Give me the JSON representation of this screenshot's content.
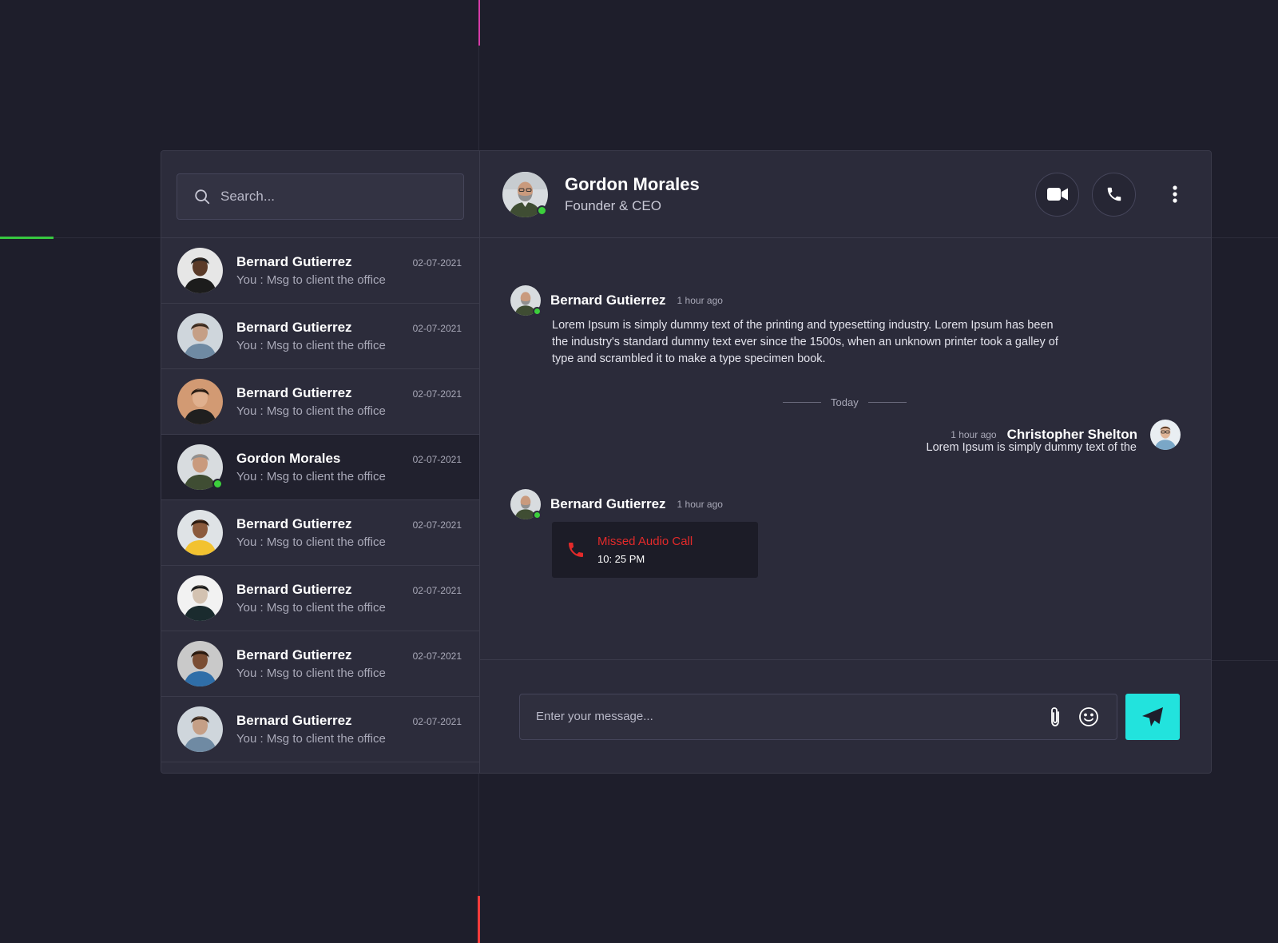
{
  "search": {
    "placeholder": "Search..."
  },
  "contacts": [
    {
      "name": "Bernard Gutierrez",
      "date": "02-07-2021",
      "preview": "You : Msg to client the office",
      "avatar": "man-suit"
    },
    {
      "name": "Bernard Gutierrez",
      "date": "02-07-2021",
      "preview": "You : Msg to client the office",
      "avatar": "man-denim"
    },
    {
      "name": "Bernard Gutierrez",
      "date": "02-07-2021",
      "preview": "You : Msg to client the office",
      "avatar": "man-sunglasses"
    },
    {
      "name": "Gordon Morales",
      "date": "02-07-2021",
      "preview": "You : Msg to client the office",
      "avatar": "man-bald",
      "active": true,
      "online": true
    },
    {
      "name": "Bernard Gutierrez",
      "date": "02-07-2021",
      "preview": "You : Msg to client the office",
      "avatar": "woman-yellow"
    },
    {
      "name": "Bernard Gutierrez",
      "date": "02-07-2021",
      "preview": "You : Msg to client the office",
      "avatar": "person-mug"
    },
    {
      "name": "Bernard Gutierrez",
      "date": "02-07-2021",
      "preview": "You : Msg to client the office",
      "avatar": "woman-curly"
    },
    {
      "name": "Bernard Gutierrez",
      "date": "02-07-2021",
      "preview": "You : Msg to client the office",
      "avatar": "man-denim"
    }
  ],
  "header": {
    "name": "Gordon Morales",
    "role": "Founder & CEO",
    "video_icon": "video-camera-icon",
    "call_icon": "phone-icon",
    "more_icon": "vertical-dots-icon"
  },
  "messages": {
    "first": {
      "sender": "Bernard Gutierrez",
      "time": "1 hour ago",
      "text": "Lorem Ipsum is simply dummy text of the printing and typesetting industry. Lorem Ipsum has been the industry's standard dummy text ever since the 1500s, when an unknown printer took a galley of type and scrambled it to make a type specimen book."
    },
    "divider": "Today",
    "reply": {
      "sender": "Christopher Shelton",
      "time": "1 hour ago",
      "text": "Lorem Ipsum is simply dummy text of the"
    },
    "call": {
      "sender": "Bernard Gutierrez",
      "time": "1 hour ago",
      "title": "Missed Audio Call",
      "call_time": "10: 25 PM"
    }
  },
  "composer": {
    "placeholder": "Enter your message..."
  },
  "colors": {
    "background": "#1e1e2b",
    "panel": "#2b2b3a",
    "accent": "#22e3dd",
    "online": "#3ccf3c",
    "missed": "#e32a2a"
  }
}
